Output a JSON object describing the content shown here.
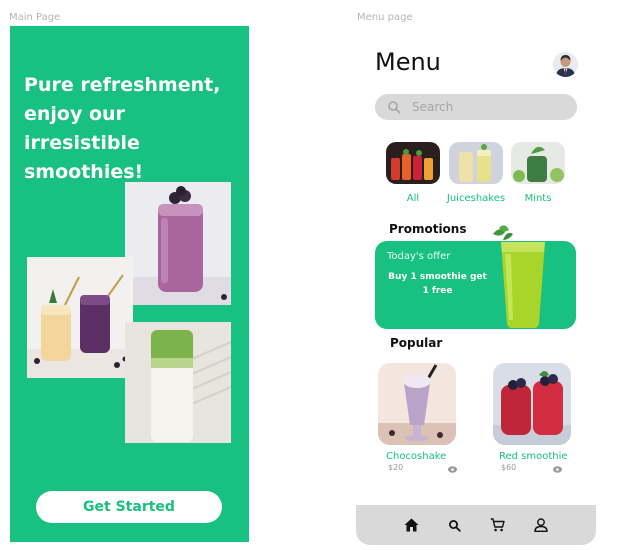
{
  "labels": {
    "main_page": "Main Page",
    "menu_page": "Menu page"
  },
  "main": {
    "headline": "Pure refreshment, enjoy our irresistible smoothies!",
    "cta_label": "Get Started",
    "accent_color": "#18c081"
  },
  "menu": {
    "title": "Menu",
    "search": {
      "placeholder": "Search",
      "icon": "search-icon"
    },
    "categories": [
      {
        "label": "All"
      },
      {
        "label": "Juiceshakes"
      },
      {
        "label": "Mints"
      }
    ],
    "promotions": {
      "title": "Promotions",
      "subtitle": "Today's offer",
      "offer": "Buy 1 smoothie get 1 free"
    },
    "popular": {
      "title": "Popular",
      "items": [
        {
          "name": "Chocoshake",
          "price": "$20"
        },
        {
          "name": "Red smoothie",
          "price": "$60"
        }
      ]
    },
    "nav": [
      "home-icon",
      "search-icon",
      "cart-icon",
      "profile-icon"
    ]
  }
}
